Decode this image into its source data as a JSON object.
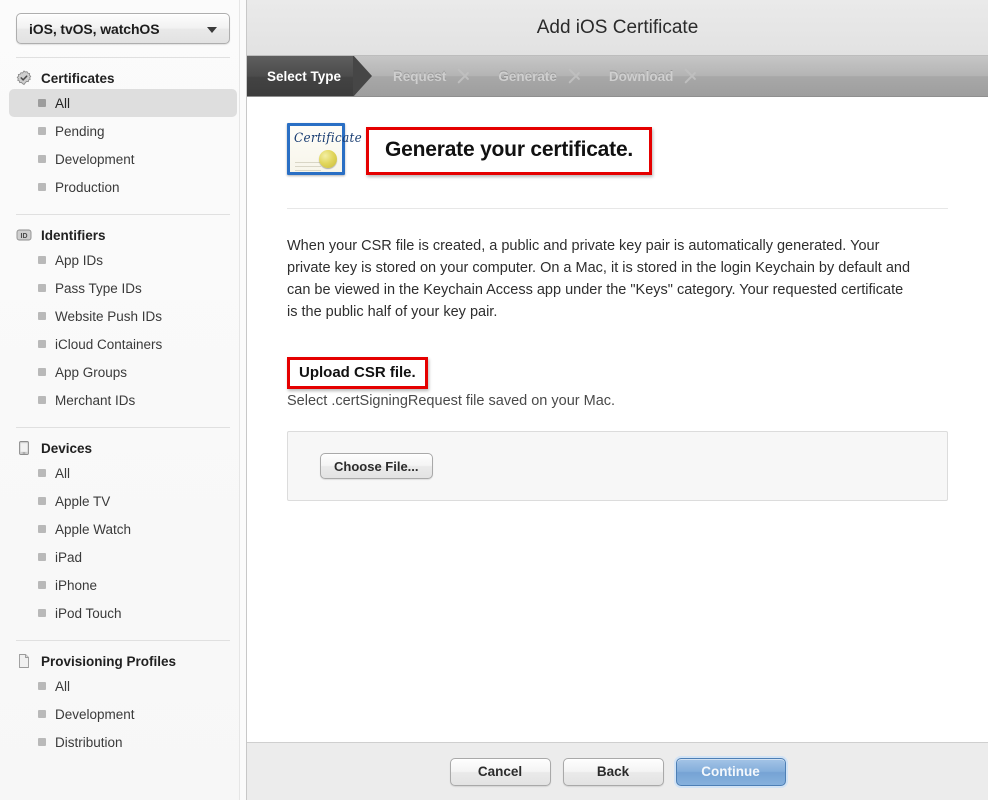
{
  "sidebar": {
    "os_select": {
      "value": "iOS, tvOS, watchOS",
      "caret_icon": "chevron-down-icon"
    },
    "sections": [
      {
        "id": "certificates",
        "label": "Certificates",
        "icon": "certificate-seal-icon",
        "items": [
          {
            "label": "All",
            "selected": true
          },
          {
            "label": "Pending",
            "selected": false
          },
          {
            "label": "Development",
            "selected": false
          },
          {
            "label": "Production",
            "selected": false
          }
        ]
      },
      {
        "id": "identifiers",
        "label": "Identifiers",
        "icon": "id-badge-icon",
        "items": [
          {
            "label": "App IDs",
            "selected": false
          },
          {
            "label": "Pass Type IDs",
            "selected": false
          },
          {
            "label": "Website Push IDs",
            "selected": false
          },
          {
            "label": "iCloud Containers",
            "selected": false
          },
          {
            "label": "App Groups",
            "selected": false
          },
          {
            "label": "Merchant IDs",
            "selected": false
          }
        ]
      },
      {
        "id": "devices",
        "label": "Devices",
        "icon": "iphone-device-icon",
        "items": [
          {
            "label": "All",
            "selected": false
          },
          {
            "label": "Apple TV",
            "selected": false
          },
          {
            "label": "Apple Watch",
            "selected": false
          },
          {
            "label": "iPad",
            "selected": false
          },
          {
            "label": "iPhone",
            "selected": false
          },
          {
            "label": "iPod Touch",
            "selected": false
          }
        ]
      },
      {
        "id": "provisioning-profiles",
        "label": "Provisioning Profiles",
        "icon": "document-page-icon",
        "items": [
          {
            "label": "All",
            "selected": false
          },
          {
            "label": "Development",
            "selected": false
          },
          {
            "label": "Distribution",
            "selected": false
          }
        ]
      }
    ]
  },
  "header": {
    "title": "Add iOS Certificate"
  },
  "stepper": {
    "steps": [
      {
        "label": "Select Type",
        "state": "active"
      },
      {
        "label": "Request",
        "state": "todo"
      },
      {
        "label": "Generate",
        "state": "todo"
      },
      {
        "label": "Download",
        "state": "todo"
      }
    ]
  },
  "content": {
    "cert_icon": {
      "name": "certificate-icon",
      "script_text": "Certificate"
    },
    "hero_title": "Generate your certificate.",
    "body_copy": "When your CSR file is created, a public and private key pair is automatically generated. Your private key is stored on your computer. On a Mac, it is stored in the login Keychain by default and can be viewed in the Keychain Access app under the \"Keys\" category. Your requested certificate is the public half of your key pair.",
    "upload": {
      "title": "Upload CSR file.",
      "subtitle": "Select .certSigningRequest file saved on your Mac.",
      "choose_file_label": "Choose File..."
    }
  },
  "footer": {
    "cancel_label": "Cancel",
    "back_label": "Back",
    "continue_label": "Continue"
  },
  "colors": {
    "highlight_red": "#e50000",
    "accent_blue": "#84aedb",
    "step_active_bg": "#464646",
    "cert_icon_border": "#2a6fc4",
    "cert_seal_gold": "#e2d75e"
  }
}
